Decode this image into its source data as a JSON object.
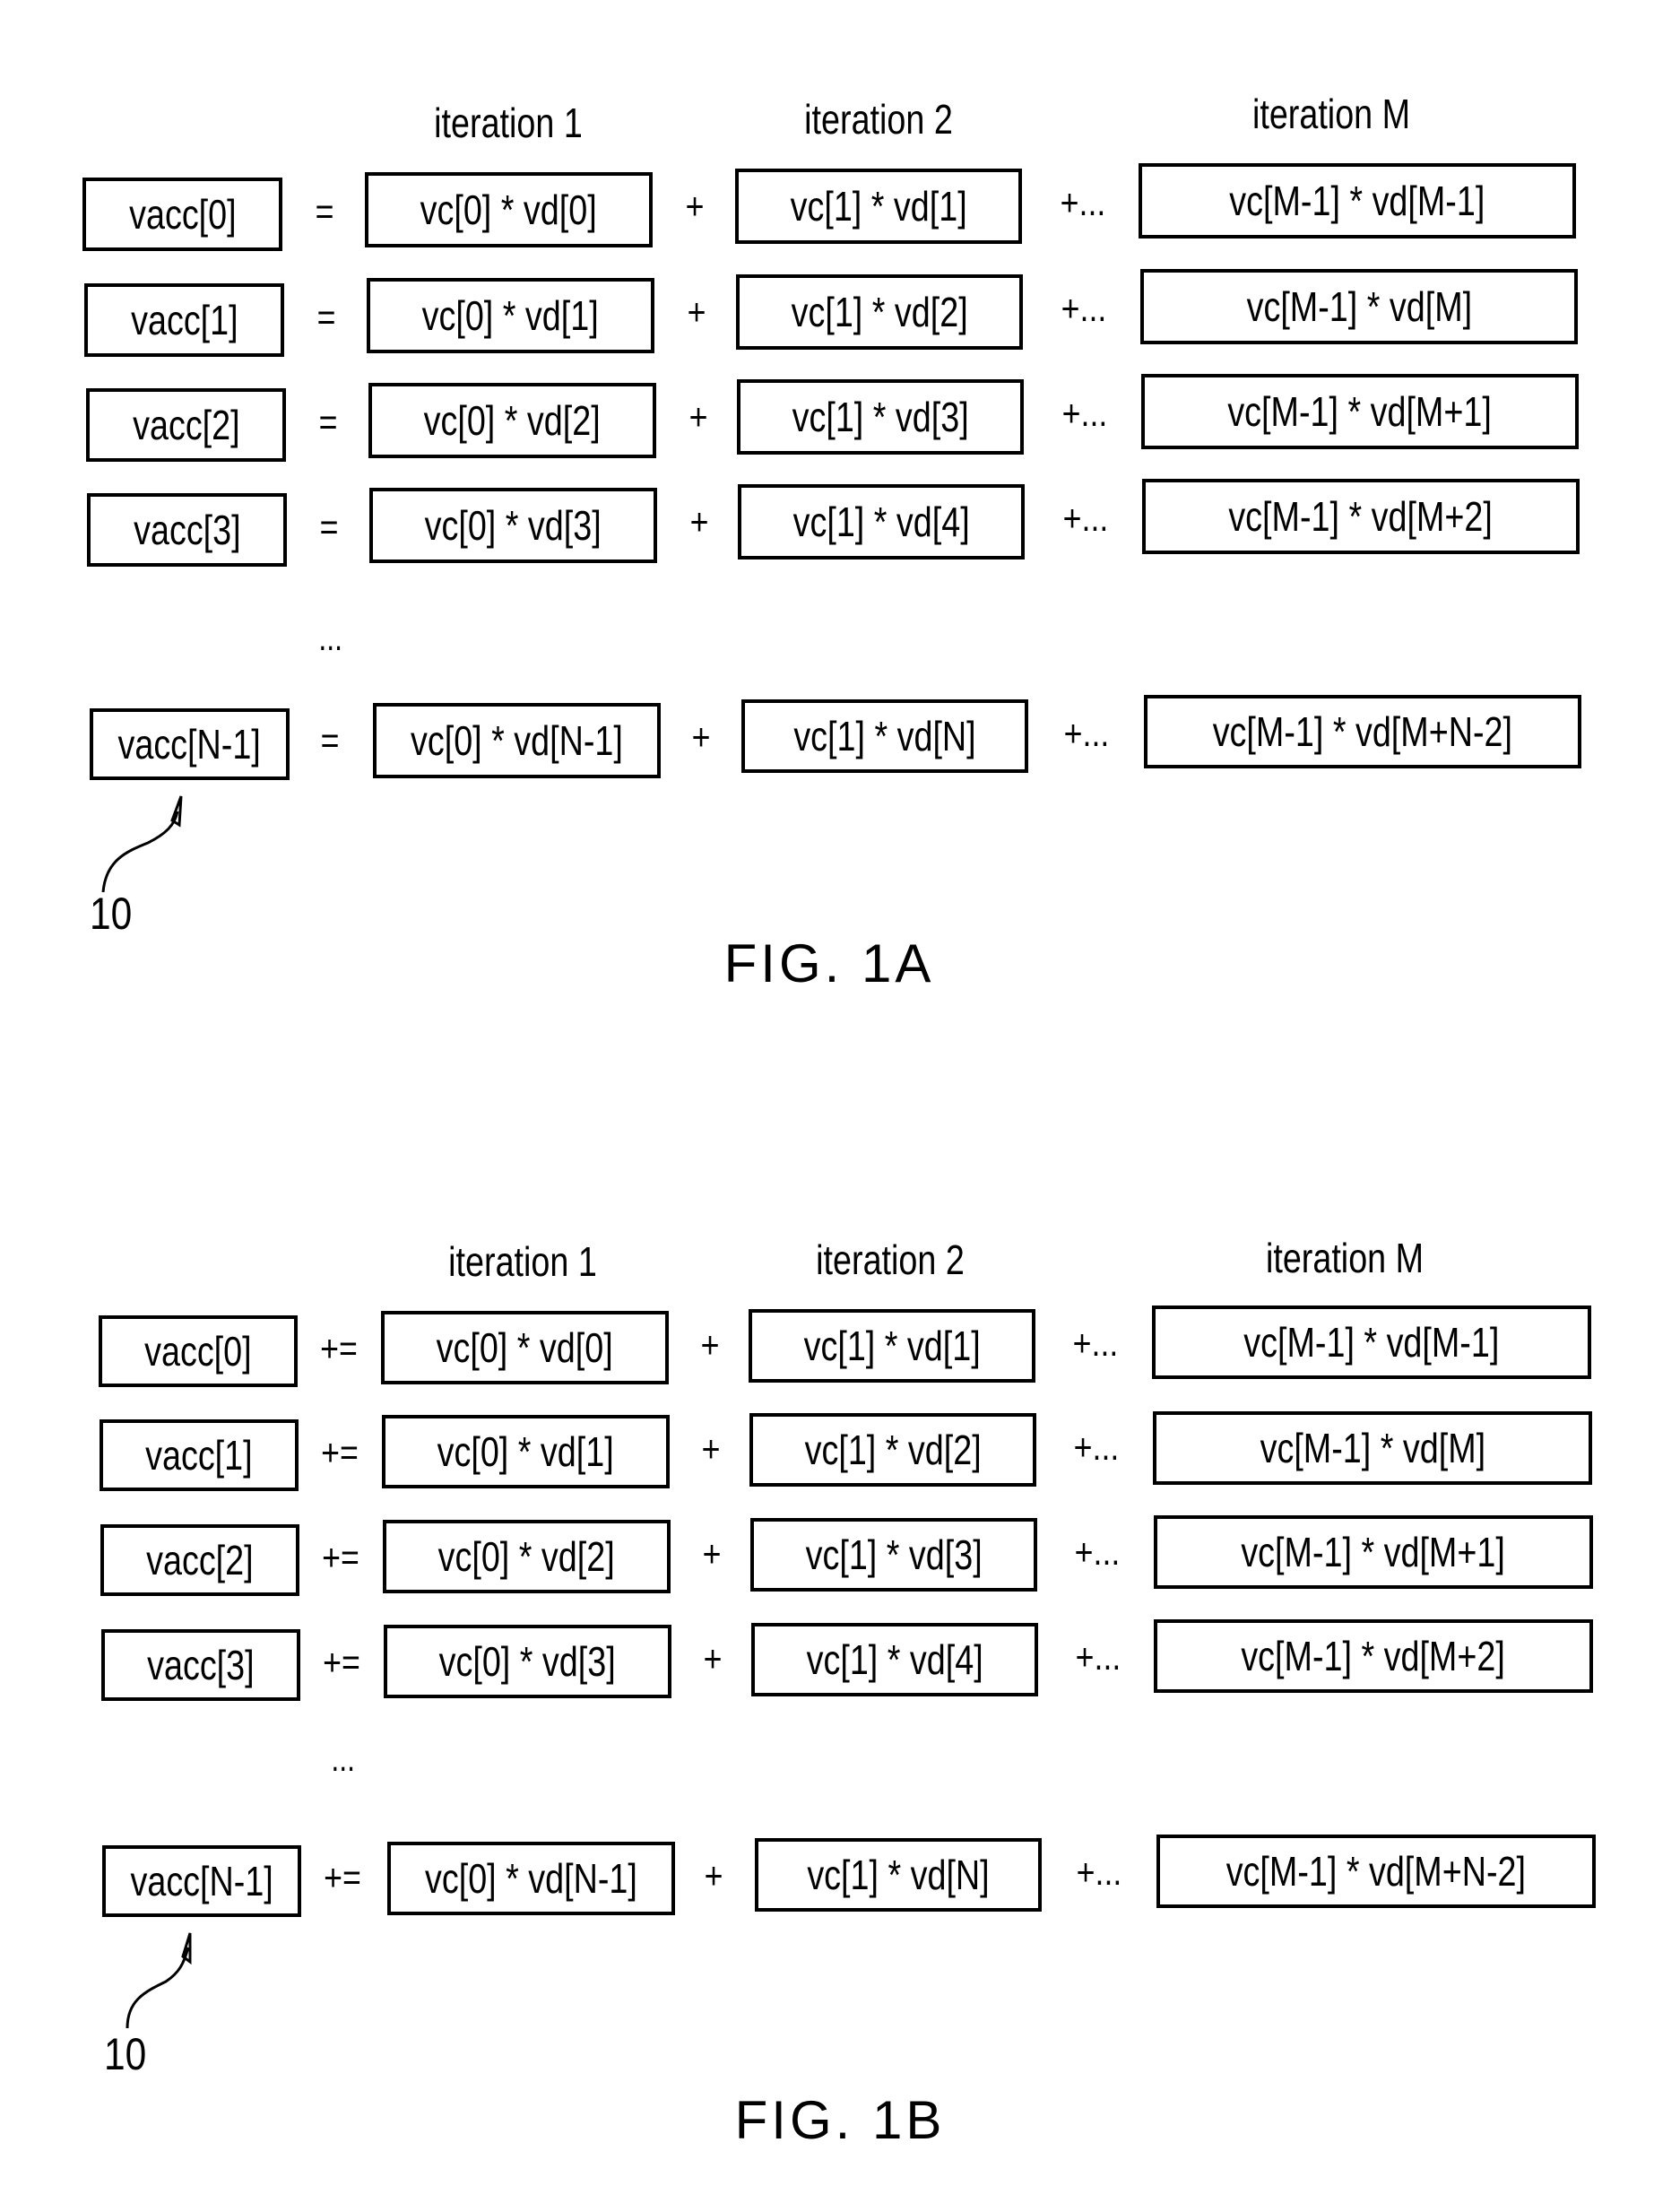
{
  "figures": [
    {
      "id": "fig1a",
      "caption": "FIG. 1A",
      "reference_numeral": "10",
      "column_headers": [
        "iteration 1",
        "iteration 2",
        "iteration M"
      ],
      "assign_operator": "=",
      "plus_operator": "+",
      "continue_operator": "+...",
      "ellipsis": "...",
      "rows": [
        {
          "lhs": "vacc[0]",
          "terms": [
            "vc[0] * vd[0]",
            "vc[1] * vd[1]",
            "vc[M-1] * vd[M-1]"
          ]
        },
        {
          "lhs": "vacc[1]",
          "terms": [
            "vc[0] * vd[1]",
            "vc[1] * vd[2]",
            "vc[M-1] * vd[M]"
          ]
        },
        {
          "lhs": "vacc[2]",
          "terms": [
            "vc[0] * vd[2]",
            "vc[1] * vd[3]",
            "vc[M-1] * vd[M+1]"
          ]
        },
        {
          "lhs": "vacc[3]",
          "terms": [
            "vc[0] * vd[3]",
            "vc[1] * vd[4]",
            "vc[M-1] * vd[M+2]"
          ]
        },
        {
          "lhs": "vacc[N-1]",
          "terms": [
            "vc[0] * vd[N-1]",
            "vc[1] * vd[N]",
            "vc[M-1] * vd[M+N-2]"
          ]
        }
      ]
    },
    {
      "id": "fig1b",
      "caption": "FIG. 1B",
      "reference_numeral": "10",
      "column_headers": [
        "iteration 1",
        "iteration 2",
        "iteration M"
      ],
      "assign_operator": "+=",
      "plus_operator": "+",
      "continue_operator": "+...",
      "ellipsis": "...",
      "rows": [
        {
          "lhs": "vacc[0]",
          "terms": [
            "vc[0] * vd[0]",
            "vc[1] * vd[1]",
            "vc[M-1] * vd[M-1]"
          ]
        },
        {
          "lhs": "vacc[1]",
          "terms": [
            "vc[0] * vd[1]",
            "vc[1] * vd[2]",
            "vc[M-1] * vd[M]"
          ]
        },
        {
          "lhs": "vacc[2]",
          "terms": [
            "vc[0] * vd[2]",
            "vc[1] * vd[3]",
            "vc[M-1] * vd[M+1]"
          ]
        },
        {
          "lhs": "vacc[3]",
          "terms": [
            "vc[0] * vd[3]",
            "vc[1] * vd[4]",
            "vc[M-1] * vd[M+2]"
          ]
        },
        {
          "lhs": "vacc[N-1]",
          "terms": [
            "vc[0] * vd[N-1]",
            "vc[1] * vd[N]",
            "vc[M-1] * vd[M+N-2]"
          ]
        }
      ]
    }
  ]
}
